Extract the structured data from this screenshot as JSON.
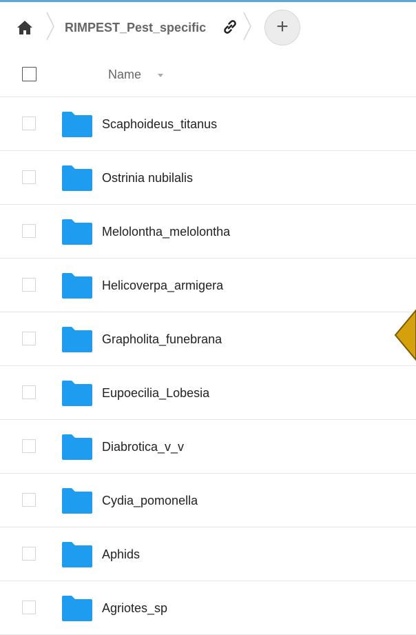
{
  "breadcrumb": {
    "home_icon": "home-icon",
    "current_folder": "RIMPEST_Pest_specific",
    "share_icon": "link-icon",
    "add_button": "+"
  },
  "list_header": {
    "name_label": "Name",
    "sort_icon": "caret-down-icon"
  },
  "folders": [
    {
      "name": "Scaphoideus_titanus"
    },
    {
      "name": "Ostrinia nubilalis"
    },
    {
      "name": "Melolontha_melolontha"
    },
    {
      "name": "Helicoverpa_armigera"
    },
    {
      "name": "Grapholita_funebrana"
    },
    {
      "name": "Eupoecilia_Lobesia"
    },
    {
      "name": "Diabrotica_v_v"
    },
    {
      "name": "Cydia_pomonella"
    },
    {
      "name": "Aphids"
    },
    {
      "name": "Agriotes_sp"
    }
  ],
  "colors": {
    "folder": "#1e9cf0",
    "accent_line": "#5aa9d6",
    "marker_fill": "#d4a10c",
    "marker_stroke": "#7a5a05"
  }
}
